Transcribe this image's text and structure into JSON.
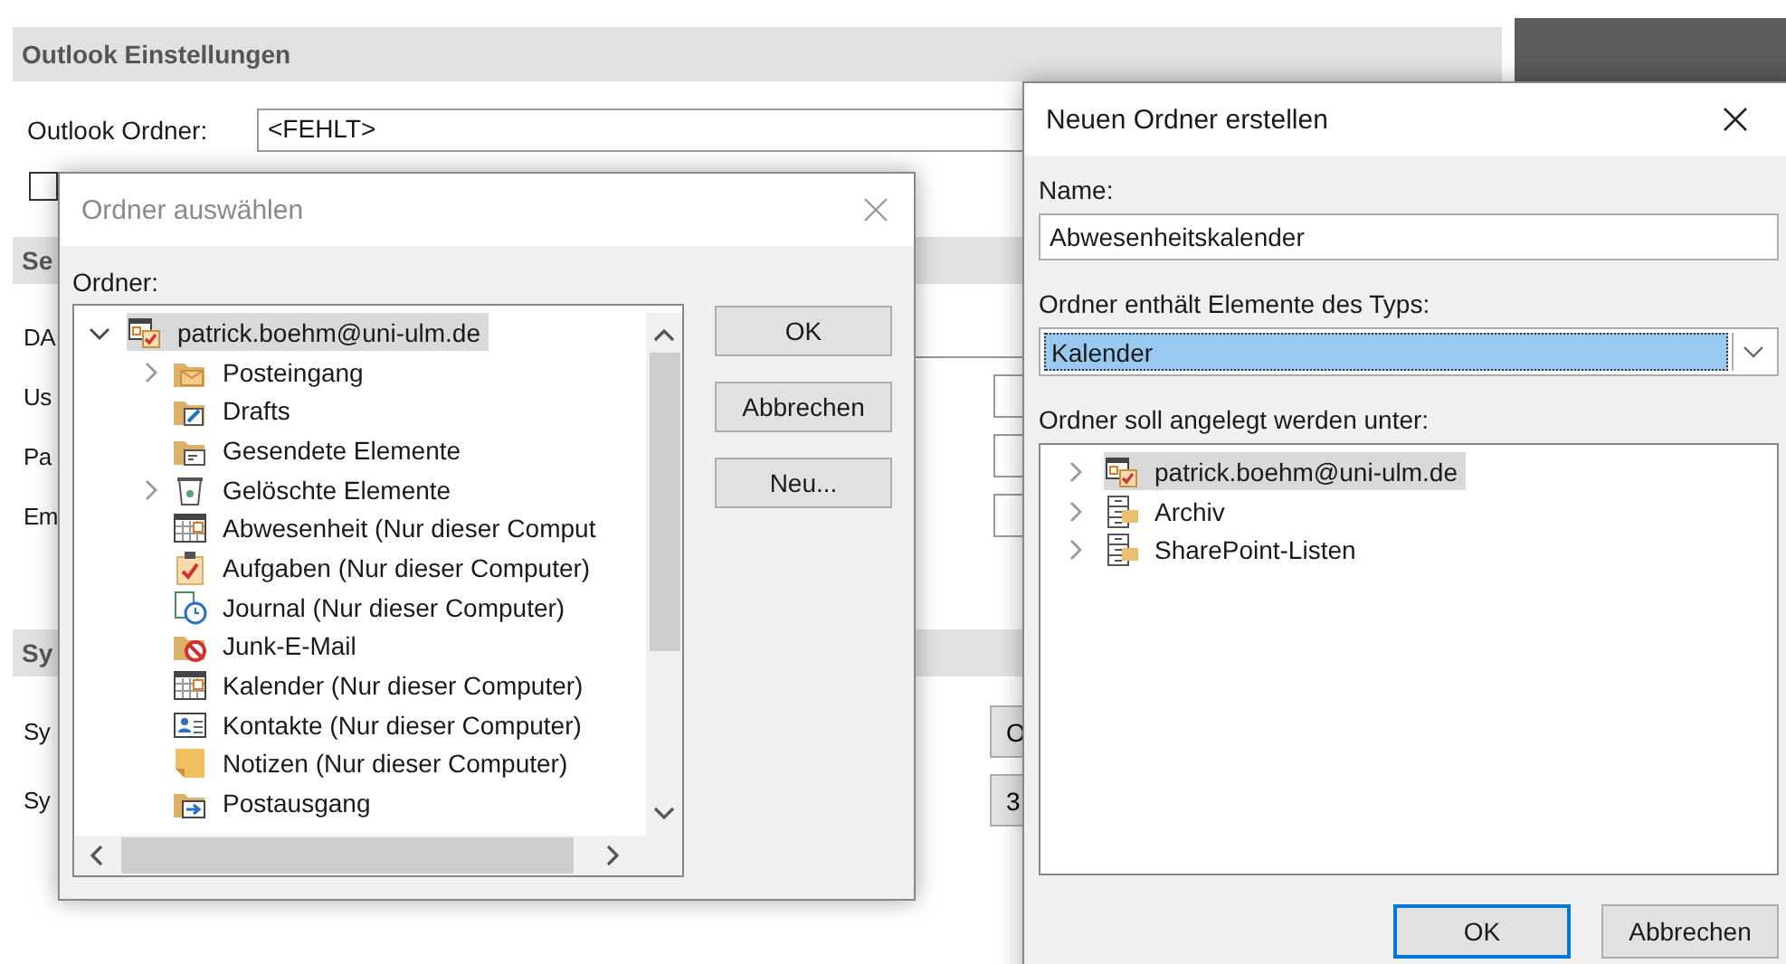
{
  "background": {
    "header": "Outlook Einstellungen",
    "folder_field": {
      "label": "Outlook Ordner:",
      "value": "<FEHLT>"
    },
    "checkbox": {
      "checked": false
    },
    "section_2": {
      "header": "Se",
      "labels": [
        "DA",
        "Us",
        "Pa",
        "Em"
      ]
    },
    "section_3": {
      "header": "Sy",
      "rows": [
        {
          "label": "Sy",
          "button": "O"
        },
        {
          "label": "Sy",
          "button": "3"
        }
      ]
    }
  },
  "select_folder_dialog": {
    "title": "Ordner auswählen",
    "tree_label": "Ordner:",
    "root": {
      "label": "patrick.boehm@uni-ulm.de",
      "kind": "mailbox",
      "expanded": true,
      "selected": true,
      "children": [
        {
          "label": "Posteingang",
          "kind": "inbox",
          "expandable": true
        },
        {
          "label": "Drafts",
          "kind": "drafts",
          "expandable": false
        },
        {
          "label": "Gesendete Elemente",
          "kind": "sent",
          "expandable": false
        },
        {
          "label": "Gelöschte Elemente",
          "kind": "trash",
          "expandable": true
        },
        {
          "label": "Abwesenheit (Nur dieser Comput",
          "kind": "calendar",
          "expandable": false
        },
        {
          "label": "Aufgaben (Nur dieser Computer)",
          "kind": "tasks",
          "expandable": false
        },
        {
          "label": "Journal (Nur dieser Computer)",
          "kind": "journal",
          "expandable": false
        },
        {
          "label": "Junk-E-Mail",
          "kind": "junk",
          "expandable": false
        },
        {
          "label": "Kalender (Nur dieser Computer)",
          "kind": "calendar",
          "expandable": false
        },
        {
          "label": "Kontakte (Nur dieser Computer)",
          "kind": "contacts",
          "expandable": false
        },
        {
          "label": "Notizen (Nur dieser Computer)",
          "kind": "notes",
          "expandable": false
        },
        {
          "label": "Postausgang",
          "kind": "outbox",
          "expandable": false
        }
      ]
    },
    "buttons": [
      "OK",
      "Abbrechen",
      "Neu..."
    ]
  },
  "new_folder_dialog": {
    "title": "Neuen Ordner erstellen",
    "name_label": "Name:",
    "name_value": "Abwesenheitskalender",
    "type_label": "Ordner enthält Elemente des Typs:",
    "type_value": "Kalender",
    "location_label": "Ordner soll angelegt werden unter:",
    "tree": [
      {
        "label": "patrick.boehm@uni-ulm.de",
        "kind": "mailbox",
        "selected": true
      },
      {
        "label": "Archiv",
        "kind": "archive",
        "selected": false
      },
      {
        "label": "SharePoint-Listen",
        "kind": "archive",
        "selected": false
      }
    ],
    "buttons": [
      {
        "label": "OK",
        "default": true
      },
      {
        "label": "Abbrechen",
        "default": false
      }
    ]
  }
}
